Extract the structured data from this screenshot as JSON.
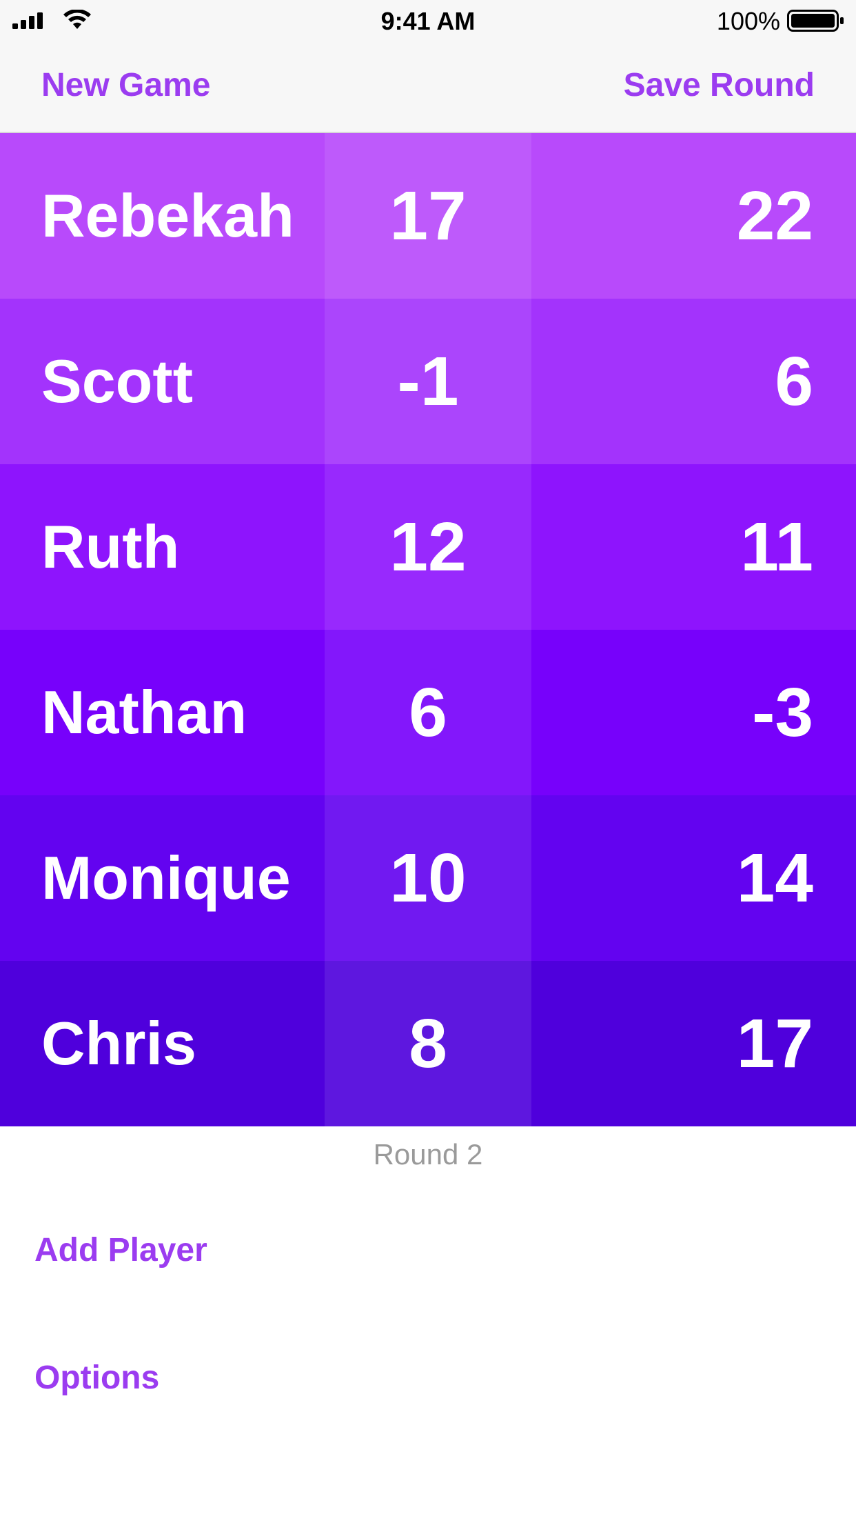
{
  "status_bar": {
    "time": "9:41 AM",
    "battery_percent": "100%",
    "signal_icon": "cellular-signal-icon",
    "wifi_icon": "wifi-icon",
    "battery_icon": "battery-icon",
    "battery_level": 1.0
  },
  "nav": {
    "left_label": "New Game",
    "right_label": "Save Round"
  },
  "colors": {
    "accent": "#9b3cf0",
    "rows": [
      "#b84afb",
      "#a333fc",
      "#8e14fd",
      "#7701fb",
      "#6303f0",
      "#4f00dc"
    ]
  },
  "players": [
    {
      "name": "Rebekah",
      "round": "17",
      "total": "22"
    },
    {
      "name": "Scott",
      "round": "-1",
      "total": "6"
    },
    {
      "name": "Ruth",
      "round": "12",
      "total": "11"
    },
    {
      "name": "Nathan",
      "round": "6",
      "total": "-3"
    },
    {
      "name": "Monique",
      "round": "10",
      "total": "14"
    },
    {
      "name": "Chris",
      "round": "8",
      "total": "17"
    }
  ],
  "round_label": "Round 2",
  "actions": {
    "add_player": "Add Player",
    "options": "Options"
  }
}
